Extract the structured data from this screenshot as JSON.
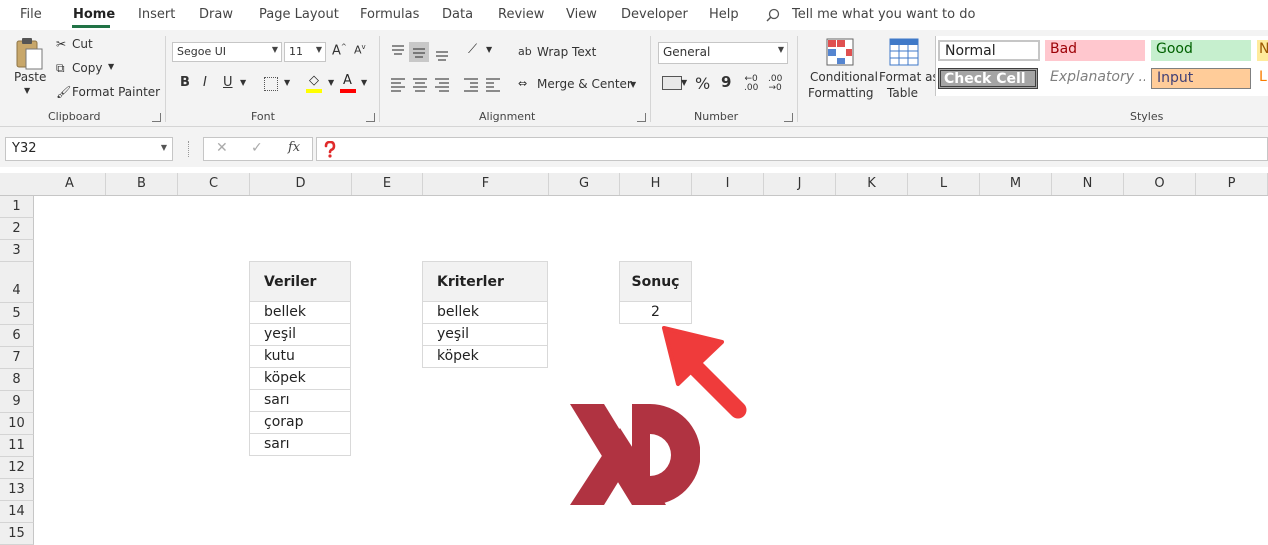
{
  "menu": [
    "File",
    "Home",
    "Insert",
    "Draw",
    "Page Layout",
    "Formulas",
    "Data",
    "Review",
    "View",
    "Developer",
    "Help"
  ],
  "tell_me": "Tell me what you want to do",
  "clipboard": {
    "paste": "Paste",
    "cut": "Cut",
    "copy": "Copy",
    "format_painter": "Format Painter",
    "label": "Clipboard"
  },
  "font": {
    "name": "Segoe UI",
    "size": "11",
    "label": "Font",
    "bold": "B",
    "italic": "I",
    "underline": "U"
  },
  "alignment": {
    "wrap_text": "Wrap Text",
    "merge_center": "Merge & Center",
    "label": "Alignment"
  },
  "number": {
    "format": "General",
    "percent": "%",
    "comma": "9",
    "label": "Number"
  },
  "styles": {
    "conditional_line1": "Conditional",
    "conditional_line2": "Formatting",
    "format_table_line1": "Format as",
    "format_table_line2": "Table",
    "label": "Styles",
    "normal": "Normal",
    "bad": "Bad",
    "good": "Good",
    "neutral": "N",
    "check_cell": "Check Cell",
    "explanatory": "Explanatory ...",
    "input": "Input",
    "linked": "L"
  },
  "name_box": "Y32",
  "formula_symbols": {
    "cancel": "✕",
    "enter": "✓",
    "fx": "fx"
  },
  "columns": [
    "A",
    "B",
    "C",
    "D",
    "E",
    "F",
    "G",
    "H",
    "I",
    "J",
    "K",
    "L",
    "M",
    "N",
    "O",
    "P"
  ],
  "rows": [
    "1",
    "2",
    "3",
    "4",
    "5",
    "6",
    "7",
    "8",
    "9",
    "10",
    "11",
    "12",
    "13",
    "14",
    "15"
  ],
  "veriler": {
    "header": "Veriler",
    "items": [
      "bellek",
      "yeşil",
      "kutu",
      "köpek",
      "sarı",
      "çorap",
      "sarı"
    ]
  },
  "kriterler": {
    "header": "Kriterler",
    "items": [
      "bellek",
      "yeşil",
      "köpek"
    ]
  },
  "sonuc": {
    "header": "Sonuç",
    "value": "2"
  },
  "colors": {
    "accent": "#217346",
    "arrow": "#ef3b3b",
    "logo": "#b03341",
    "bad_bg": "#ffc7ce",
    "bad_fg": "#9c0006",
    "good_bg": "#c6efce",
    "good_fg": "#006100",
    "input_bg": "#ffcc99",
    "input_fg": "#3f3f76",
    "neutral_bg": "#ffeb9c"
  }
}
